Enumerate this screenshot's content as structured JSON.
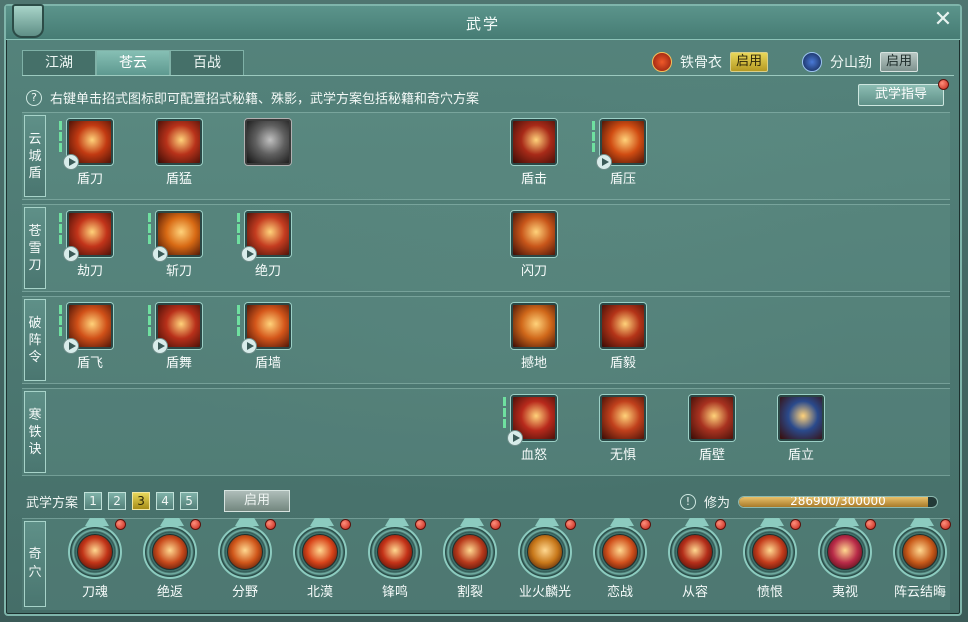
{
  "window": {
    "title": "武学"
  },
  "tabs": [
    {
      "label": "江湖",
      "active": false
    },
    {
      "label": "苍云",
      "active": true
    },
    {
      "label": "百战",
      "active": false
    }
  ],
  "stances": [
    {
      "name": "铁骨衣",
      "button": "启用",
      "state": "lit"
    },
    {
      "name": "分山劲",
      "button": "启用",
      "state": "dim"
    }
  ],
  "hint": "右键单击招式图标即可配置招式秘籍、殊影，武学方案包括秘籍和奇穴方案",
  "guide_button": "武学指导",
  "rows": [
    {
      "label": [
        "云",
        "城",
        "盾"
      ],
      "skills": [
        {
          "name": "盾刀",
          "icon": "shield-blade-icon",
          "color": "#c23a12",
          "play": true,
          "bars": 3,
          "slot": 0
        },
        {
          "name": "盾猛",
          "icon": "shield-charge-icon",
          "color": "#b8321a",
          "play": false,
          "bars": 0,
          "slot": 1
        },
        {
          "name": "",
          "icon": "armor-icon",
          "color": "#6a6a6a",
          "play": false,
          "bars": 0,
          "slot": 2,
          "grey": true
        },
        {
          "name": "盾击",
          "icon": "shield-strike-icon",
          "color": "#a82a18",
          "play": false,
          "bars": 0,
          "slot": 5
        },
        {
          "name": "盾压",
          "icon": "shield-press-icon",
          "color": "#d04c12",
          "play": true,
          "bars": 3,
          "slot": 6
        }
      ]
    },
    {
      "label": [
        "苍",
        "雪",
        "刀"
      ],
      "skills": [
        {
          "name": "劫刀",
          "icon": "blade-slash-icon",
          "color": "#c2341a",
          "play": true,
          "bars": 3,
          "slot": 0
        },
        {
          "name": "斩刀",
          "icon": "blade-chop-icon",
          "color": "#d86a14",
          "play": true,
          "bars": 3,
          "slot": 1
        },
        {
          "name": "绝刀",
          "icon": "blade-finish-icon",
          "color": "#c43c20",
          "play": true,
          "bars": 3,
          "slot": 2
        },
        {
          "name": "闪刀",
          "icon": "blade-flash-icon",
          "color": "#c8561a",
          "play": false,
          "bars": 0,
          "slot": 5
        }
      ]
    },
    {
      "label": [
        "破",
        "阵",
        "令"
      ],
      "skills": [
        {
          "name": "盾飞",
          "icon": "shield-fly-icon",
          "color": "#d05018",
          "play": true,
          "bars": 3,
          "slot": 0
        },
        {
          "name": "盾舞",
          "icon": "shield-dance-icon",
          "color": "#b8301a",
          "play": true,
          "bars": 3,
          "slot": 1
        },
        {
          "name": "盾墙",
          "icon": "shield-wall-icon",
          "color": "#d4561a",
          "play": true,
          "bars": 3,
          "slot": 2
        },
        {
          "name": "撼地",
          "icon": "quake-icon",
          "color": "#d0681a",
          "play": false,
          "bars": 0,
          "slot": 5
        },
        {
          "name": "盾毅",
          "icon": "shield-resolve-icon",
          "color": "#b43418",
          "play": false,
          "bars": 0,
          "slot": 6
        }
      ]
    },
    {
      "label": [
        "寒",
        "铁",
        "诀"
      ],
      "skills": [
        {
          "name": "血怒",
          "icon": "blood-rage-icon",
          "color": "#b82a1c",
          "play": true,
          "bars": 3,
          "slot": 5
        },
        {
          "name": "无惧",
          "icon": "fearless-icon",
          "color": "#c0401c",
          "play": false,
          "bars": 0,
          "slot": 6
        },
        {
          "name": "盾壁",
          "icon": "shield-barrier-icon",
          "color": "#a83220",
          "play": false,
          "bars": 0,
          "slot": 7
        },
        {
          "name": "盾立",
          "icon": "shield-stand-icon",
          "color": "#2a4a8c",
          "play": false,
          "bars": 0,
          "slot": 8
        }
      ]
    }
  ],
  "scheme": {
    "label": "武学方案",
    "options": [
      "1",
      "2",
      "3",
      "4",
      "5"
    ],
    "active_index": 2,
    "enable": "启用"
  },
  "xiuwei": {
    "label": "修为",
    "text": "286900/300000",
    "progress": 0.956
  },
  "qixue": {
    "label": [
      "奇",
      "穴"
    ],
    "nodes": [
      {
        "name": "刀魂",
        "icon": "blade-soul-icon",
        "color": "#c23418"
      },
      {
        "name": "绝返",
        "icon": "return-icon",
        "color": "#c84a1c"
      },
      {
        "name": "分野",
        "icon": "divide-icon",
        "color": "#d0561a"
      },
      {
        "name": "北漠",
        "icon": "desert-icon",
        "color": "#d8441a"
      },
      {
        "name": "锋鸣",
        "icon": "edge-cry-icon",
        "color": "#c43218"
      },
      {
        "name": "割裂",
        "icon": "rend-icon",
        "color": "#b83a1c"
      },
      {
        "name": "业火麟光",
        "icon": "karma-fire-icon",
        "color": "#c8781a"
      },
      {
        "name": "恋战",
        "icon": "battle-love-icon",
        "color": "#d0501c"
      },
      {
        "name": "从容",
        "icon": "calm-icon",
        "color": "#b42e1a"
      },
      {
        "name": "愤恨",
        "icon": "resent-icon",
        "color": "#c43c1c"
      },
      {
        "name": "夷视",
        "icon": "disdain-icon",
        "color": "#b82a48"
      },
      {
        "name": "阵云结晦",
        "icon": "cloud-gloom-icon",
        "color": "#c85a1a"
      }
    ]
  }
}
